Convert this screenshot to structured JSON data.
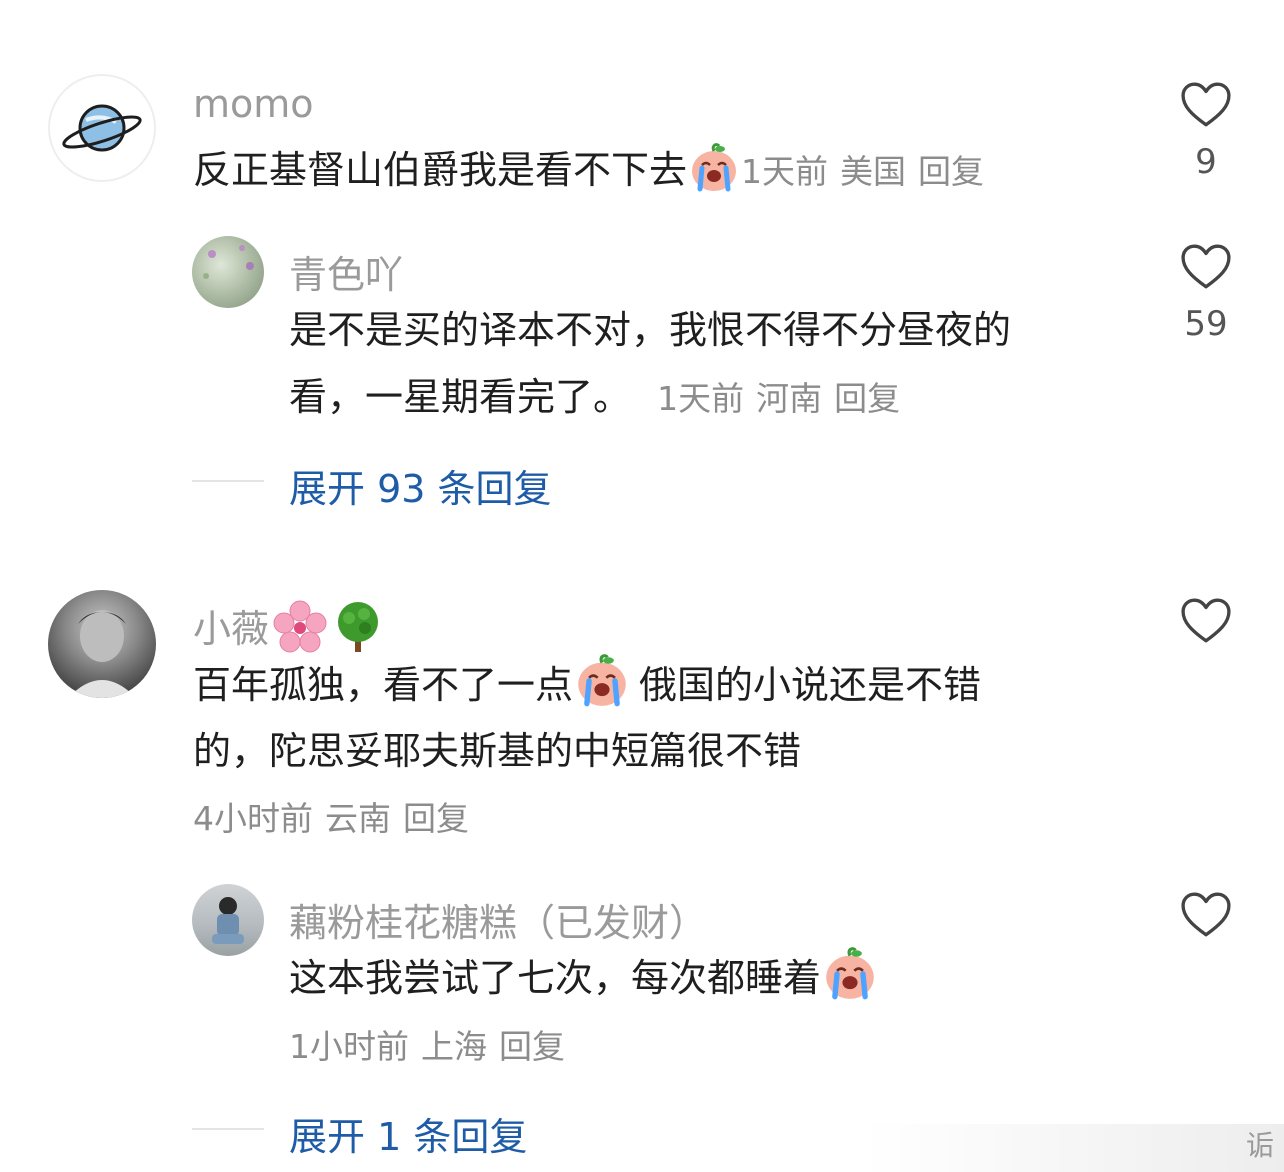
{
  "comments": [
    {
      "username": "momo",
      "text": "反正基督山伯爵我是看不下去",
      "time": "1天前",
      "location": "美国",
      "reply": "回复",
      "likes": "9"
    },
    {
      "username": "青色吖",
      "text_line1": "是不是买的译本不对，我恨不得不分昼夜的",
      "text_line2": "看，一星期看完了。",
      "time": "1天前",
      "location": "河南",
      "reply": "回复",
      "likes": "59"
    },
    {
      "username": "小薇",
      "text_part1": "百年孤独，看不了一点",
      "text_part2": "俄国的小说还是不错",
      "text_line2": "的，陀思妥耶夫斯基的中短篇很不错",
      "time": "4小时前",
      "location": "云南",
      "reply": "回复"
    },
    {
      "username": "藕粉桂花糖糕（已发财）",
      "text": "这本我尝试了七次，每次都睡着",
      "time": "1小时前",
      "location": "上海",
      "reply": "回复"
    }
  ],
  "expand1": "展开 93 条回复",
  "expand2": "展开 1 条回复",
  "watermark": "诟",
  "icons": {
    "like": "heart-outline-icon",
    "emoji_cry": "loudly-crying-peach-emoji",
    "emoji_flower": "cherry-blossom-emoji",
    "emoji_tree": "tree-emoji"
  },
  "colors": {
    "link": "#1f5ca8",
    "meta": "#8c8c8c",
    "username": "#9a9a9a"
  }
}
